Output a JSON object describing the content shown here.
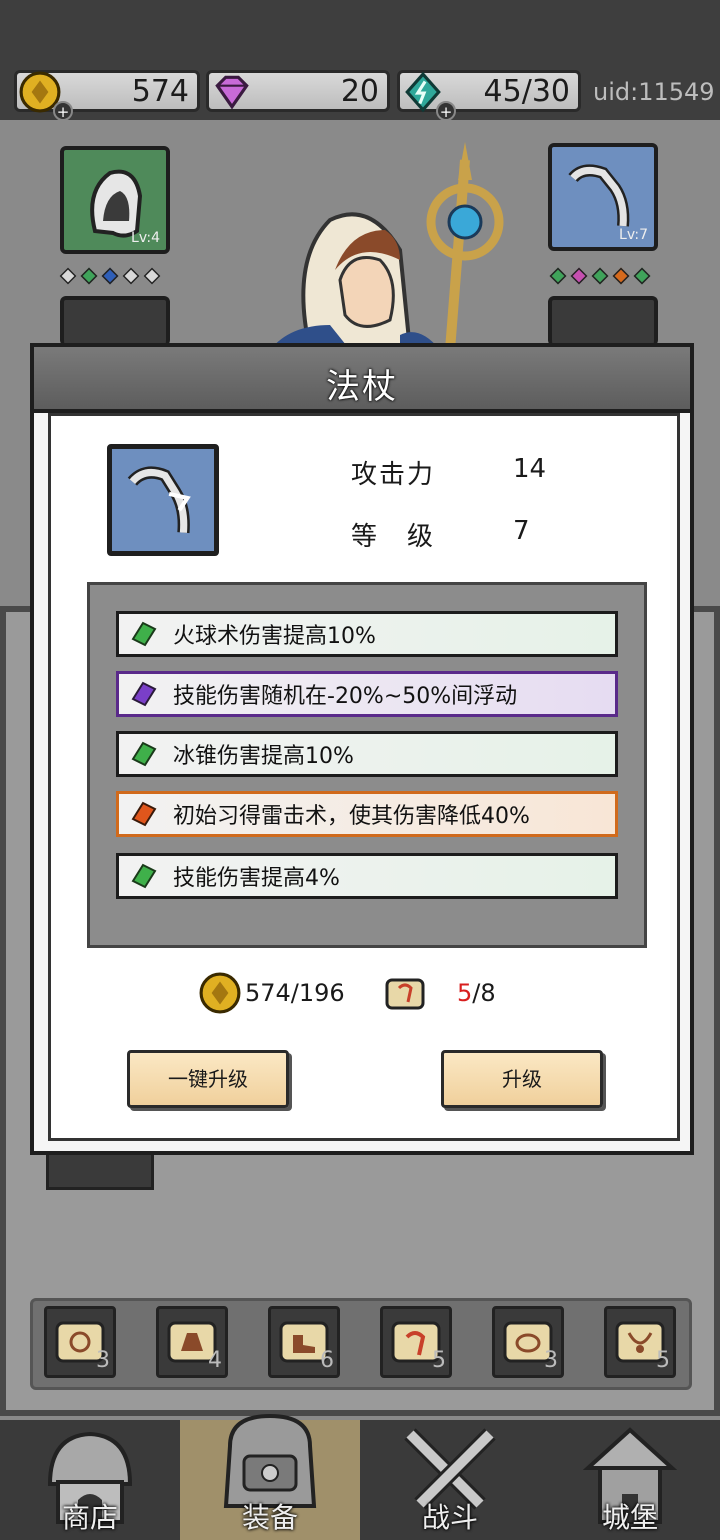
{
  "resources": {
    "gold": "574",
    "gems": "20",
    "energy": "45/30",
    "uid": "uid:11549",
    "plus_symbol": "+"
  },
  "equipment": {
    "left_slot_level": "Lv:4",
    "right_slot_level": "Lv:7",
    "left_gem_colors": [
      "#d8d8d8",
      "#3fa35a",
      "#2f5fb8",
      "#d8d8d8",
      "#d8d8d8"
    ],
    "right_gem_colors": [
      "#3fa35a",
      "#c54fb0",
      "#3fa35a",
      "#d66a1c",
      "#3fa35a"
    ]
  },
  "modal": {
    "title": "法杖",
    "attack_label": "攻击力",
    "attack_value": "14",
    "level_label": "等　级",
    "level_value": "7",
    "affixes": [
      {
        "text": "火球术伤害提高10%",
        "rarity": "green",
        "color": "#3fb04a"
      },
      {
        "text": "技能伤害随机在-20%~50%间浮动",
        "rarity": "purple",
        "color": "#7a3fc8"
      },
      {
        "text": "冰锥伤害提高10%",
        "rarity": "green",
        "color": "#3fb04a"
      },
      {
        "text": "初始习得雷击术，使其伤害降低40%",
        "rarity": "orange",
        "color": "#e0561c"
      },
      {
        "text": "技能伤害提高4%",
        "rarity": "green",
        "color": "#3fb04a"
      }
    ],
    "gold_cost": "574/196",
    "scroll_have": "5",
    "scroll_need": "/8",
    "one_key_upgrade": "一键升级",
    "upgrade": "升级"
  },
  "scrolls": [
    "3",
    "4",
    "6",
    "5",
    "3",
    "5"
  ],
  "tabs": {
    "shop": "商店",
    "equip": "装备",
    "battle": "战斗",
    "castle": "城堡"
  }
}
